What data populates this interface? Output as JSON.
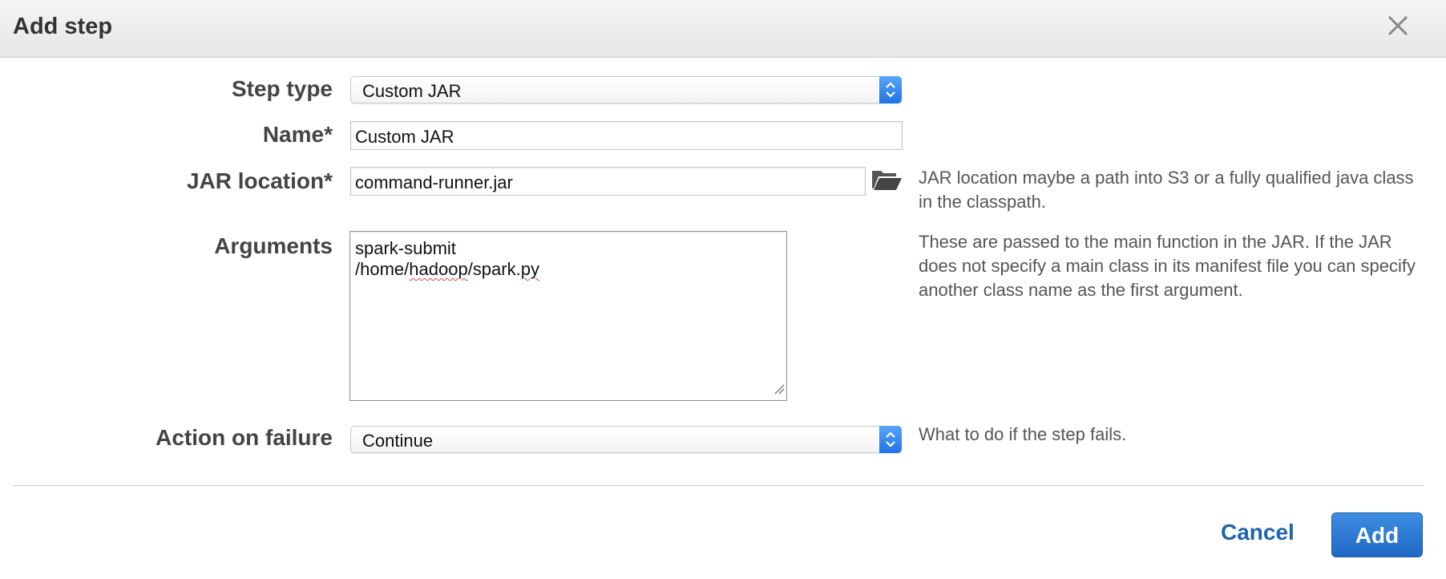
{
  "dialog": {
    "title": "Add step",
    "close_icon": "close-icon"
  },
  "form": {
    "step_type": {
      "label": "Step type",
      "value": "Custom JAR"
    },
    "name": {
      "label": "Name*",
      "value": "Custom JAR"
    },
    "jar_location": {
      "label": "JAR location*",
      "value": "command-runner.jar",
      "help": "JAR location maybe a path into S3 or a fully qualified java class in the classpath.",
      "browse_icon": "folder-open-icon"
    },
    "arguments": {
      "label": "Arguments",
      "lines": [
        {
          "parts": [
            "spark-submit"
          ]
        },
        {
          "parts": [
            "/home/",
            "hadoop",
            "/spark.",
            "py"
          ]
        }
      ],
      "help": "These are passed to the main function in the JAR. If the JAR does not specify a main class in its manifest file you can specify another class name as the first argument."
    },
    "action_on_failure": {
      "label": "Action on failure",
      "value": "Continue",
      "help": "What to do if the step fails."
    }
  },
  "footer": {
    "cancel_label": "Cancel",
    "add_label": "Add"
  },
  "colors": {
    "accent": "#1e64b4",
    "select_arrow": "#2a7fe9",
    "help_text": "#555555"
  }
}
